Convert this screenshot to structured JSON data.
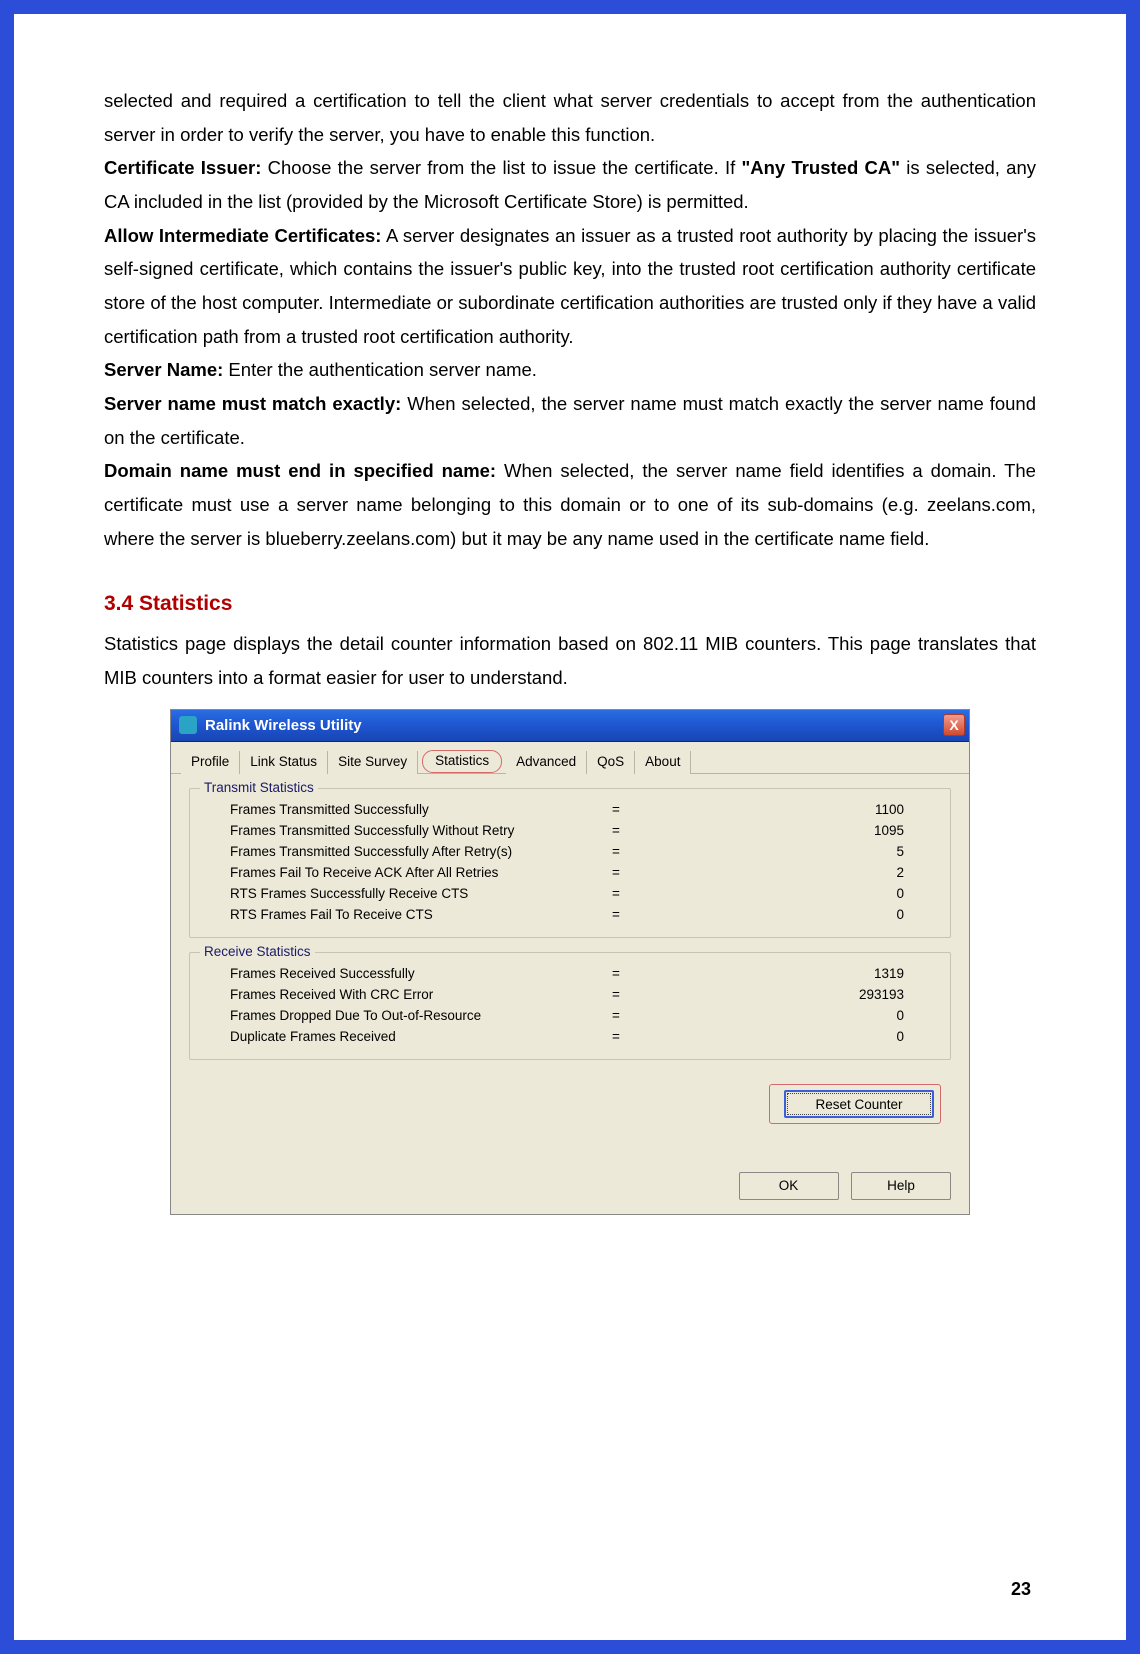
{
  "text": {
    "intro": "selected and required a certification to tell the client what server credentials to accept from the authentication server in order to verify the server, you have to enable this function.",
    "cert_issuer_label": "Certificate Issuer:",
    "cert_issuer_text_a": " Choose the server from the list to issue the certificate. If ",
    "cert_issuer_bold": "\"Any Trusted CA\"",
    "cert_issuer_text_b": " is selected, any CA included in the list (provided by the Microsoft Certificate Store) is permitted.",
    "allow_intermediate_label": "Allow Intermediate Certificates:",
    "allow_intermediate_text": " A server designates an issuer as a trusted root authority by placing the issuer's self-signed certificate, which contains the issuer's public key, into the trusted root certification authority certificate store of the host computer. Intermediate or subordinate certification authorities are trusted only if they have a valid certification path from a trusted root certification authority.",
    "server_name_label": "Server Name:",
    "server_name_text": " Enter the authentication server name.",
    "match_exactly_label": "Server name must match exactly:",
    "match_exactly_text": " When selected, the server name must match exactly the server name found on the certificate.",
    "domain_label": "Domain name must end in specified name:",
    "domain_text": " When selected, the server name field identifies a domain. The certificate must use a server name belonging to this domain or to one of its sub-domains (e.g. zeelans.com, where the server is blueberry.zeelans.com) but it may be any name used in the certificate name field."
  },
  "heading": "3.4  Statistics",
  "stats_intro": "Statistics page displays the detail counter information based on 802.11 MIB counters. This page translates that MIB counters into a format easier for user to understand.",
  "window": {
    "title": "Ralink Wireless Utility",
    "close": "X",
    "tabs": [
      "Profile",
      "Link Status",
      "Site Survey",
      "Statistics",
      "Advanced",
      "QoS",
      "About"
    ],
    "tx_group": "Transmit Statistics",
    "rx_group": "Receive Statistics",
    "tx": [
      {
        "label": "Frames Transmitted Successfully",
        "val": "1100"
      },
      {
        "label": "Frames Transmitted Successfully  Without Retry",
        "val": "1095"
      },
      {
        "label": "Frames Transmitted Successfully After Retry(s)",
        "val": "5"
      },
      {
        "label": "Frames Fail To Receive ACK After All Retries",
        "val": "2"
      },
      {
        "label": "RTS Frames Successfully Receive CTS",
        "val": "0"
      },
      {
        "label": "RTS Frames Fail To Receive CTS",
        "val": "0"
      }
    ],
    "rx": [
      {
        "label": "Frames Received Successfully",
        "val": "1319"
      },
      {
        "label": "Frames Received With CRC Error",
        "val": "293193"
      },
      {
        "label": "Frames Dropped Due To Out-of-Resource",
        "val": "0"
      },
      {
        "label": "Duplicate Frames Received",
        "val": "0"
      }
    ],
    "reset_btn": "Reset Counter",
    "ok_btn": "OK",
    "help_btn": "Help"
  },
  "page_number": "23"
}
